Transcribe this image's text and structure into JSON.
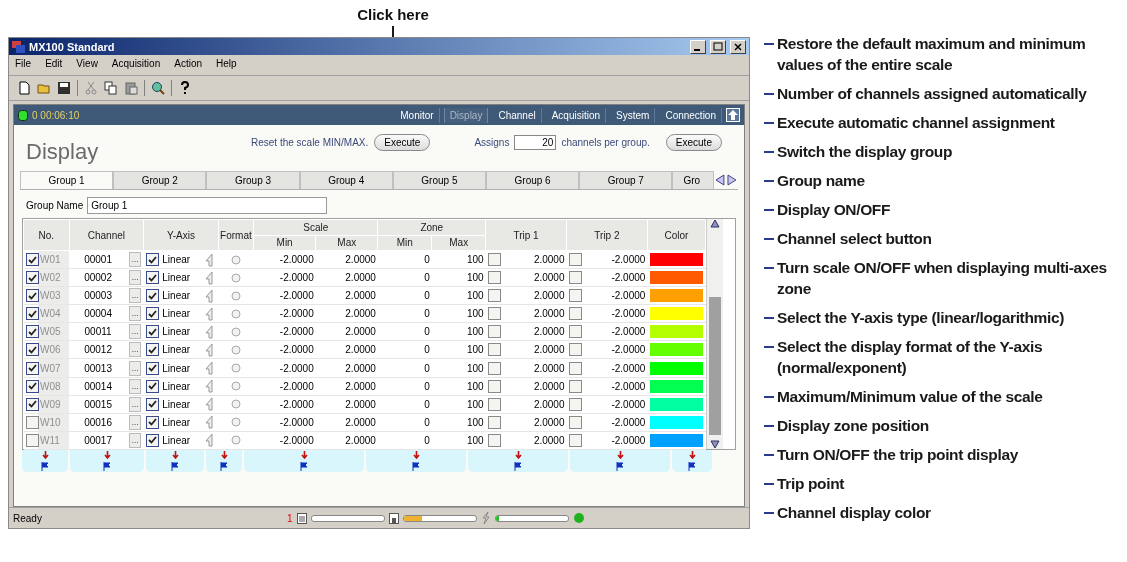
{
  "annotation_header": {
    "label": "Click here"
  },
  "window": {
    "title": "MX100 Standard"
  },
  "menu": [
    "File",
    "Edit",
    "View",
    "Acquisition",
    "Action",
    "Help"
  ],
  "nav": {
    "elapsed": "0 00:06:10",
    "tabs": [
      {
        "label": "Monitor",
        "selected": false
      },
      {
        "label": "Display",
        "selected": true
      },
      {
        "label": "Channel",
        "selected": false
      },
      {
        "label": "Acquisition",
        "selected": false
      },
      {
        "label": "System",
        "selected": false
      },
      {
        "label": "Connection",
        "selected": false
      }
    ]
  },
  "page_title": "Display",
  "reset": {
    "label": "Reset the scale MIN/MAX.",
    "button": "Execute"
  },
  "assign": {
    "prefix": "Assigns",
    "value": "20",
    "suffix": "channels per group.",
    "button": "Execute"
  },
  "group_tabs": [
    {
      "label": "Group 1",
      "selected": true
    },
    {
      "label": "Group 2",
      "selected": false
    },
    {
      "label": "Group 3",
      "selected": false
    },
    {
      "label": "Group 4",
      "selected": false
    },
    {
      "label": "Group 5",
      "selected": false
    },
    {
      "label": "Group 6",
      "selected": false
    },
    {
      "label": "Group 7",
      "selected": false
    },
    {
      "label": "Gro",
      "selected": false
    }
  ],
  "group_name": {
    "label": "Group Name",
    "value": "Group 1"
  },
  "table": {
    "headers": {
      "no": "No.",
      "channel": "Channel",
      "y_axis": "Y-Axis",
      "format": "Format",
      "scale": "Scale",
      "zone": "Zone",
      "scale_min": "Min",
      "scale_max": "Max",
      "zone_min": "Min",
      "zone_max": "Max",
      "trip1": "Trip 1",
      "trip2": "Trip 2",
      "color_label": "Color"
    },
    "rows": [
      {
        "display": true,
        "no": "W01",
        "channel": "00001",
        "button": "...",
        "scale_on": true,
        "y_axis": "Linear",
        "scale_min": "-2.0000",
        "scale_max": "2.0000",
        "zone_min": "0",
        "zone_max": "100",
        "trip1_on": false,
        "trip1": "2.0000",
        "trip2_on": false,
        "trip2": "-2.0000",
        "color": "#ff0000"
      },
      {
        "display": true,
        "no": "W02",
        "channel": "00002",
        "button": "...",
        "scale_on": true,
        "y_axis": "Linear",
        "scale_min": "-2.0000",
        "scale_max": "2.0000",
        "zone_min": "0",
        "zone_max": "100",
        "trip1_on": false,
        "trip1": "2.0000",
        "trip2_on": false,
        "trip2": "-2.0000",
        "color": "#ff5a00"
      },
      {
        "display": true,
        "no": "W03",
        "channel": "00003",
        "button": "...",
        "scale_on": true,
        "y_axis": "Linear",
        "scale_min": "-2.0000",
        "scale_max": "2.0000",
        "zone_min": "0",
        "zone_max": "100",
        "trip1_on": false,
        "trip1": "2.0000",
        "trip2_on": false,
        "trip2": "-2.0000",
        "color": "#ffa000"
      },
      {
        "display": true,
        "no": "W04",
        "channel": "00004",
        "button": "...",
        "scale_on": true,
        "y_axis": "Linear",
        "scale_min": "-2.0000",
        "scale_max": "2.0000",
        "zone_min": "0",
        "zone_max": "100",
        "trip1_on": false,
        "trip1": "2.0000",
        "trip2_on": false,
        "trip2": "-2.0000",
        "color": "#ffff00"
      },
      {
        "display": true,
        "no": "W05",
        "channel": "00011",
        "button": "...",
        "scale_on": true,
        "y_axis": "Linear",
        "scale_min": "-2.0000",
        "scale_max": "2.0000",
        "zone_min": "0",
        "zone_max": "100",
        "trip1_on": false,
        "trip1": "2.0000",
        "trip2_on": false,
        "trip2": "-2.0000",
        "color": "#b4ff00"
      },
      {
        "display": true,
        "no": "W06",
        "channel": "00012",
        "button": "...",
        "scale_on": true,
        "y_axis": "Linear",
        "scale_min": "-2.0000",
        "scale_max": "2.0000",
        "zone_min": "0",
        "zone_max": "100",
        "trip1_on": false,
        "trip1": "2.0000",
        "trip2_on": false,
        "trip2": "-2.0000",
        "color": "#64ff00"
      },
      {
        "display": true,
        "no": "W07",
        "channel": "00013",
        "button": "...",
        "scale_on": true,
        "y_axis": "Linear",
        "scale_min": "-2.0000",
        "scale_max": "2.0000",
        "zone_min": "0",
        "zone_max": "100",
        "trip1_on": false,
        "trip1": "2.0000",
        "trip2_on": false,
        "trip2": "-2.0000",
        "color": "#00ff00"
      },
      {
        "display": true,
        "no": "W08",
        "channel": "00014",
        "button": "...",
        "scale_on": true,
        "y_axis": "Linear",
        "scale_min": "-2.0000",
        "scale_max": "2.0000",
        "zone_min": "0",
        "zone_max": "100",
        "trip1_on": false,
        "trip1": "2.0000",
        "trip2_on": false,
        "trip2": "-2.0000",
        "color": "#00ff50"
      },
      {
        "display": true,
        "no": "W09",
        "channel": "00015",
        "button": "...",
        "scale_on": true,
        "y_axis": "Linear",
        "scale_min": "-2.0000",
        "scale_max": "2.0000",
        "zone_min": "0",
        "zone_max": "100",
        "trip1_on": false,
        "trip1": "2.0000",
        "trip2_on": false,
        "trip2": "-2.0000",
        "color": "#00ffa0"
      },
      {
        "display": false,
        "no": "W10",
        "channel": "00016",
        "button": "...",
        "scale_on": true,
        "y_axis": "Linear",
        "scale_min": "-2.0000",
        "scale_max": "2.0000",
        "zone_min": "0",
        "zone_max": "100",
        "trip1_on": false,
        "trip1": "2.0000",
        "trip2_on": false,
        "trip2": "-2.0000",
        "color": "#00ffff"
      },
      {
        "display": false,
        "no": "W11",
        "channel": "00017",
        "button": "...",
        "scale_on": true,
        "y_axis": "Linear",
        "scale_min": "-2.0000",
        "scale_max": "2.0000",
        "zone_min": "0",
        "zone_max": "100",
        "trip1_on": false,
        "trip1": "2.0000",
        "trip2_on": false,
        "trip2": "-2.0000",
        "color": "#00a0ff"
      }
    ]
  },
  "status_bar": {
    "text": "Ready",
    "page": "1",
    "memory": {
      "level": 0.25
    },
    "signal": {
      "level": 0.05
    }
  },
  "callouts": [
    {
      "text": "Restore the default maximum and minimum values of the entire scale"
    },
    {
      "text": "Number of channels assigned automatically"
    },
    {
      "text": "Execute automatic channel assignment"
    },
    {
      "text": "Switch the display group"
    },
    {
      "text": "Group name"
    },
    {
      "text": "Display ON/OFF"
    },
    {
      "text": "Channel select button"
    },
    {
      "text": "Turn scale ON/OFF when displaying multi-axes zone"
    },
    {
      "text": "Select the Y-axis type (linear/logarithmic)"
    },
    {
      "text": "Select the display format of the Y-axis (normal/exponent)"
    },
    {
      "text": "Maximum/Minimum value of the scale"
    },
    {
      "text": "Display zone position"
    },
    {
      "text": "Turn ON/OFF the trip point display"
    },
    {
      "text": "Trip point"
    },
    {
      "text": "Channel display color"
    }
  ]
}
